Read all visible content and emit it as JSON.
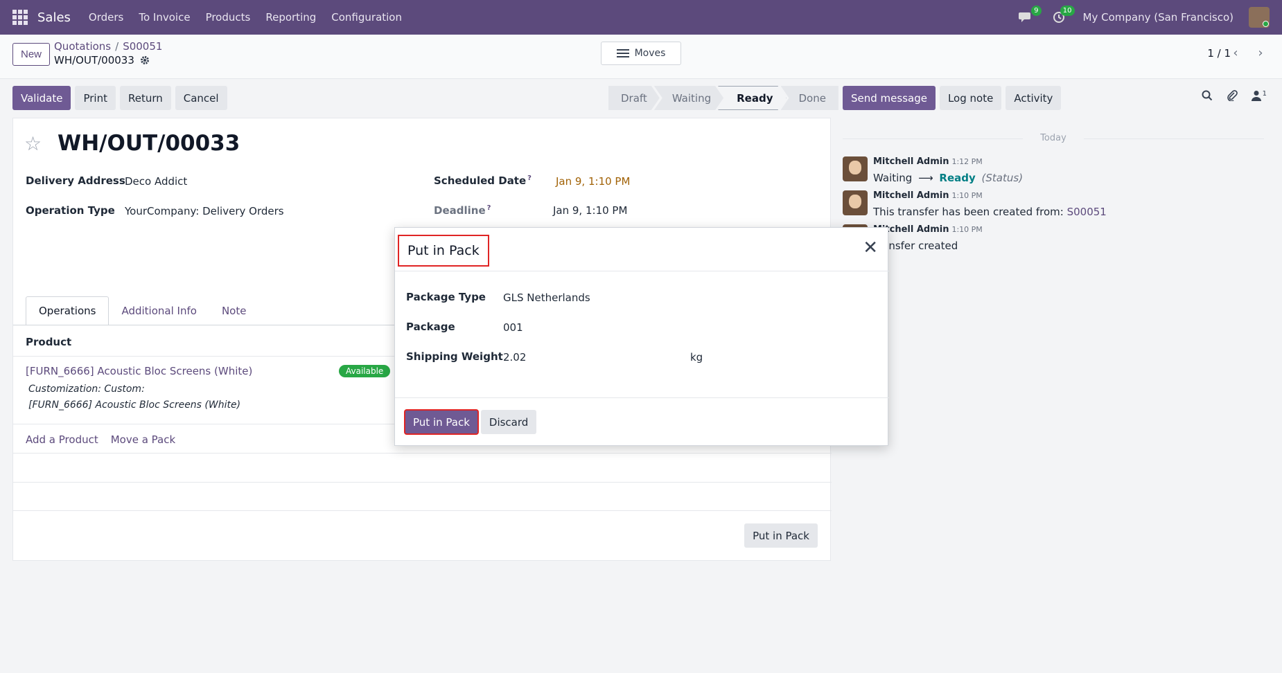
{
  "navbar": {
    "app": "Sales",
    "menu": [
      "Orders",
      "To Invoice",
      "Products",
      "Reporting",
      "Configuration"
    ],
    "messages_count": "9",
    "activities_count": "10",
    "company": "My Company (San Francisco)"
  },
  "control": {
    "new_label": "New",
    "breadcrumb": [
      "Quotations",
      "S00051"
    ],
    "record_name": "WH/OUT/00033",
    "moves_label": "Moves",
    "pager": "1 / 1"
  },
  "actions": {
    "validate": "Validate",
    "print": "Print",
    "return": "Return",
    "cancel": "Cancel"
  },
  "status": {
    "steps": [
      "Draft",
      "Waiting",
      "Ready",
      "Done"
    ],
    "active": "Ready"
  },
  "form": {
    "title": "WH/OUT/00033",
    "delivery_address_label": "Delivery Address",
    "delivery_address": "Deco Addict",
    "operation_type_label": "Operation Type",
    "operation_type": "YourCompany: Delivery Orders",
    "scheduled_date_label": "Scheduled Date",
    "scheduled_date": "Jan 9, 1:10 PM",
    "deadline_label": "Deadline",
    "deadline": "Jan 9, 1:10 PM",
    "help_mark": "?",
    "tabs": [
      "Operations",
      "Additional Info",
      "Note"
    ],
    "product_header": "Product",
    "product": "[FURN_6666] Acoustic Bloc Screens (White)",
    "availability": "Available",
    "custom_line1": "Customization: Custom:",
    "custom_line2": "[FURN_6666] Acoustic Bloc Screens (White)",
    "add_product": "Add a Product",
    "move_pack": "Move a Pack",
    "put_in_pack": "Put in Pack"
  },
  "chatter": {
    "send_message": "Send message",
    "log_note": "Log note",
    "activity": "Activity",
    "followers_count": "1",
    "today": "Today",
    "messages": [
      {
        "author": "Mitchell Admin",
        "time": "1:12 PM",
        "from": "Waiting",
        "arrow": "⟶",
        "to": "Ready",
        "field": "(Status)"
      },
      {
        "author": "Mitchell Admin",
        "time": "1:10 PM",
        "text": "This transfer has been created from:",
        "link": "S00051"
      },
      {
        "author": "Mitchell Admin",
        "time": "1:10 PM",
        "text": "Transfer created"
      }
    ]
  },
  "modal": {
    "title": "Put in Pack",
    "package_type_label": "Package Type",
    "package_type": "GLS Netherlands",
    "package_label": "Package",
    "package": "001",
    "shipping_weight_label": "Shipping Weight",
    "shipping_weight": "2.02",
    "weight_unit": "kg",
    "confirm_label": "Put in Pack",
    "discard_label": "Discard"
  },
  "colors": {
    "brand": "#5c4a7c",
    "primary_button": "#6f5a94",
    "available": "#28a745",
    "highlight": "#e02424"
  }
}
